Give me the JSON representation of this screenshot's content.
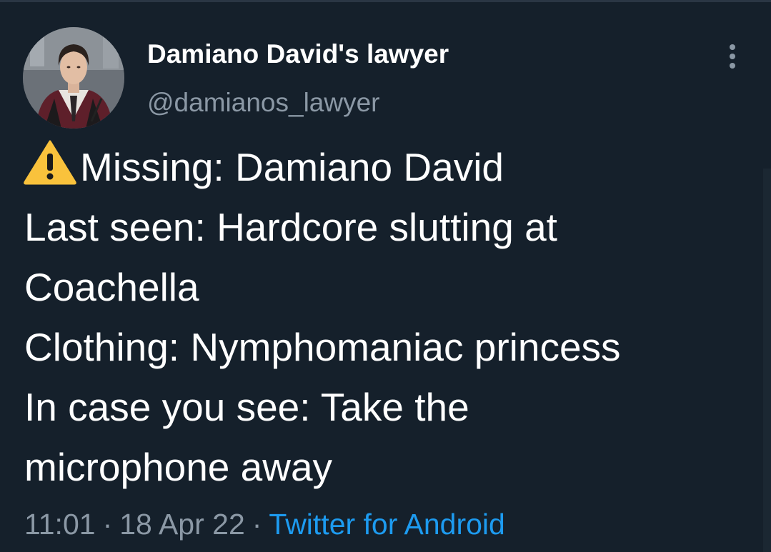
{
  "author": {
    "display_name": "Damiano David's lawyer",
    "handle": "@damianos_lawyer",
    "avatar_icon": "profile-photo"
  },
  "tweet": {
    "lines": [
      "Missing: Damiano David",
      "Last seen: Hardcore slutting at",
      "Coachella",
      "Clothing: Nymphomaniac princess",
      "In case you see: Take the",
      "microphone away"
    ],
    "leading_icon": "warning-icon"
  },
  "meta": {
    "time": "11:01",
    "separator": "·",
    "date": "18 Apr 22",
    "source": "Twitter for Android"
  },
  "colors": {
    "background": "#15202b",
    "text": "#ffffff",
    "secondary_text": "#8b98a5",
    "link": "#1d9bf0",
    "warning": "#f9c23c"
  }
}
